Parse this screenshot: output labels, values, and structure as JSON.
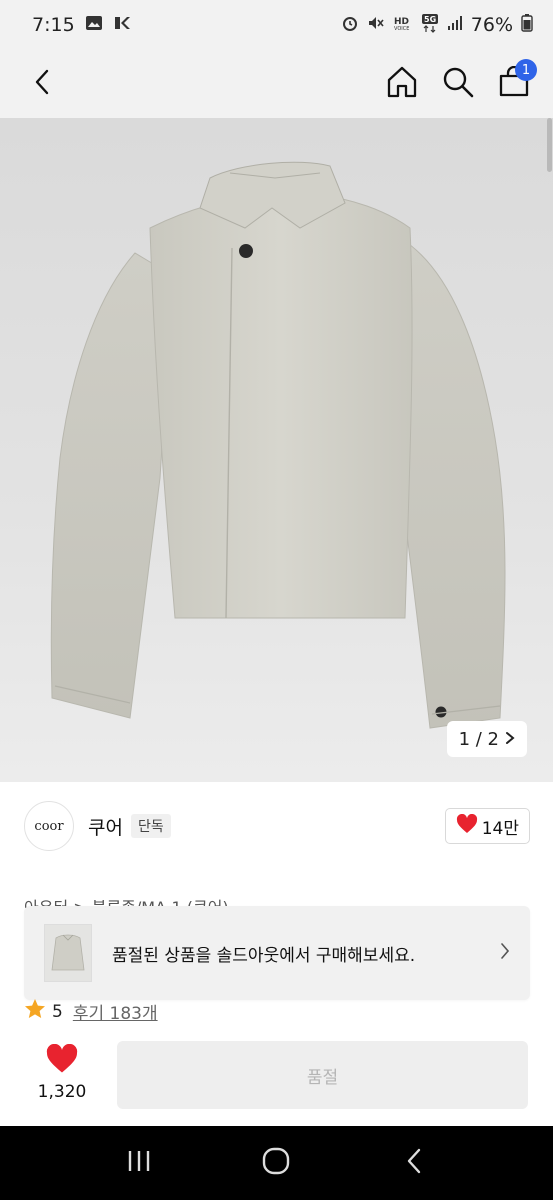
{
  "status_bar": {
    "time": "7:15",
    "battery": "76%",
    "icons_left": [
      "gallery-icon",
      "k-app-icon"
    ],
    "icons_right": [
      "alarm-icon",
      "mute-icon",
      "hd-voice-icon",
      "5g-icon",
      "signal-icon",
      "battery-icon"
    ]
  },
  "header": {
    "cart_count": "1",
    "icons": [
      "back-icon",
      "home-icon",
      "search-icon",
      "cart-icon"
    ]
  },
  "gallery": {
    "counter": "1 / 2",
    "product_image": "beige cropped jacket"
  },
  "brand": {
    "logo_text": "coor",
    "name": "쿠어",
    "badge": "단독",
    "likes": "14만"
  },
  "breadcrumb": "아우터 > 블루종/MA-1 (쿠어)",
  "soldout_banner": {
    "text": "품절된 상품을 솔드아웃에서 구매해보세요."
  },
  "rating": {
    "score": "5",
    "review_label": "후기 183개"
  },
  "bottom_bar": {
    "wish_count": "1,320",
    "button_label": "품절"
  },
  "colors": {
    "heart": "#e8232f",
    "badge_blue": "#2f64e8",
    "star": "#f5a623"
  }
}
